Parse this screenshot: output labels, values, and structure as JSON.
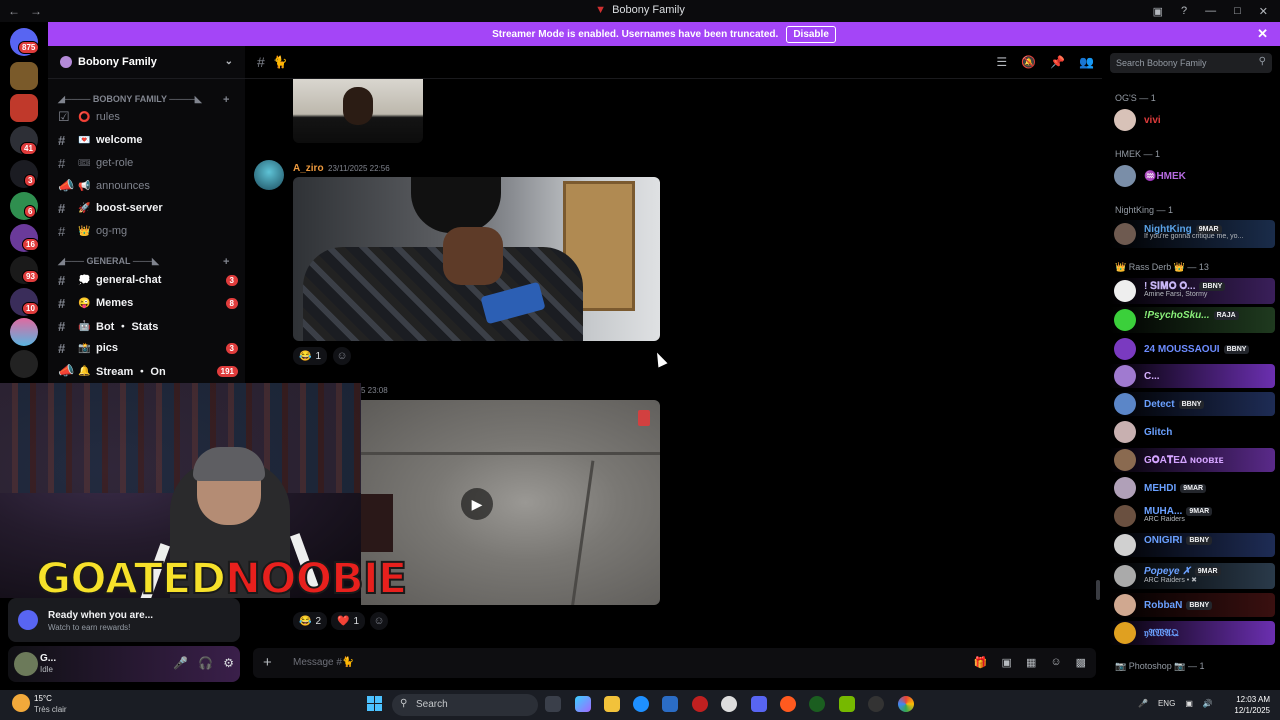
{
  "window": {
    "title": "Bobony Family"
  },
  "banner": {
    "text": "Streamer Mode is enabled. Usernames have been truncated.",
    "button": "Disable",
    "color": "#a445f7"
  },
  "rail": {
    "badges": [
      "875",
      "41",
      "3",
      "6",
      "16",
      "93",
      "10"
    ]
  },
  "sidebar": {
    "guild_name": "Bobony Family",
    "category1": "◢──── BOBONY FAMILY ────◣",
    "category2": "◢─── GENERAL ───◣",
    "channels": [
      {
        "name": "rules",
        "emoji": "⭕",
        "bright": false,
        "badge": ""
      },
      {
        "name": "welcome",
        "emoji": "💌",
        "bright": true,
        "badge": ""
      },
      {
        "name": "get-role",
        "emoji": "🎟",
        "bright": false,
        "badge": ""
      },
      {
        "name": "announces",
        "emoji": "📢",
        "bright": false,
        "badge": ""
      },
      {
        "name": "boost-server",
        "emoji": "🚀",
        "bright": true,
        "badge": ""
      },
      {
        "name": "og-mg",
        "emoji": "👑",
        "bright": false,
        "badge": ""
      },
      {
        "name": "general-chat",
        "emoji": "💭",
        "bright": true,
        "badge": "3"
      },
      {
        "name": "Memes",
        "emoji": "😜",
        "bright": true,
        "badge": "8"
      },
      {
        "name": "Bot ・ Stats",
        "emoji": "🤖",
        "bright": true,
        "badge": ""
      },
      {
        "name": "pics",
        "emoji": "📸",
        "bright": true,
        "badge": "3"
      },
      {
        "name": "Stream ・ On",
        "emoji": "🔔",
        "bright": true,
        "badge": "191"
      }
    ]
  },
  "header": {
    "channel": "🐈",
    "search_placeholder": "Search Bobony Family"
  },
  "messages": {
    "author": "A_ziro",
    "timestamp": "23/11/2025 22:56",
    "reactions1": [
      {
        "emoji": "😂",
        "count": "1"
      }
    ],
    "timestamp2": "5 23:08",
    "reactions2": [
      {
        "emoji": "😂",
        "count": "2"
      },
      {
        "emoji": "❤️",
        "count": "1"
      }
    ]
  },
  "overlay": {
    "logo_part1": "GOATED",
    "logo_part2": "NOOBIE"
  },
  "ready_panel": {
    "title": "Ready when you are...",
    "subtitle": "Watch to earn rewards!"
  },
  "user_panel": {
    "name": "G...",
    "status": "Idle"
  },
  "composer": {
    "placeholder": "Message #🐈"
  },
  "members": {
    "roles": [
      "OG'S — 1",
      "HMEK — 1",
      "NightKing — 1",
      "👑 Rass Derb 👑 — 13",
      "📷 Photoshop 📷 — 1"
    ],
    "list": [
      {
        "name": "vivi",
        "color": "#e03c3c",
        "tag": "",
        "sub": ""
      },
      {
        "name": "♒HMEK",
        "color": "#b66be0",
        "tag": "",
        "sub": ""
      },
      {
        "name": "NightKing",
        "color": "#5aa2e6",
        "tag": "9MAR",
        "sub": "If you're gonna critique me, yo..."
      },
      {
        "name": "! 𝐒𝐈𝐌𝐎 𝐎...",
        "color": "#c8b6f5",
        "tag": "BBNY",
        "sub": "Amine Farsi, Stormy"
      },
      {
        "name": "!PsychoSku...",
        "color": "#8af07a",
        "tag": "RAJA",
        "sub": ""
      },
      {
        "name": "24 MOUSSAOUI",
        "color": "#6d8cff",
        "tag": "BBNY",
        "sub": ""
      },
      {
        "name": "C...",
        "color": "#d7b2ff",
        "tag": "",
        "sub": ""
      },
      {
        "name": "Detect",
        "color": "#6aa0ff",
        "tag": "BBNY",
        "sub": ""
      },
      {
        "name": "Glitch",
        "color": "#6aa0ff",
        "tag": "",
        "sub": ""
      },
      {
        "name": "G𝐎Α𝐓ΕΔ ɴᴏᴏʙɪᴇ",
        "color": "#d4a4ff",
        "tag": "",
        "sub": ""
      },
      {
        "name": "MEHDI",
        "color": "#6aa0ff",
        "tag": "9MAR",
        "sub": ""
      },
      {
        "name": "MUHA...",
        "color": "#6aa0ff",
        "tag": "9MAR",
        "sub": "ARC Raiders"
      },
      {
        "name": "ONIGIRI",
        "color": "#6aa0ff",
        "tag": "BBNY",
        "sub": ""
      },
      {
        "name": "Popeye ✗",
        "color": "#6aa0ff",
        "tag": "9MAR",
        "sub": "ARC Raiders • ✖"
      },
      {
        "name": "RobbaN",
        "color": "#6aa0ff",
        "tag": "BBNY",
        "sub": ""
      },
      {
        "name": "𝔶𝔄𝔚𝔄𝔔",
        "color": "#6aa0ff",
        "tag": "",
        "sub": ""
      }
    ]
  },
  "taskbar": {
    "temp": "15°C",
    "weather": "Très clair",
    "search": "Search",
    "lang": "ENG",
    "time": "12:03 AM",
    "date": "12/1/2025"
  }
}
